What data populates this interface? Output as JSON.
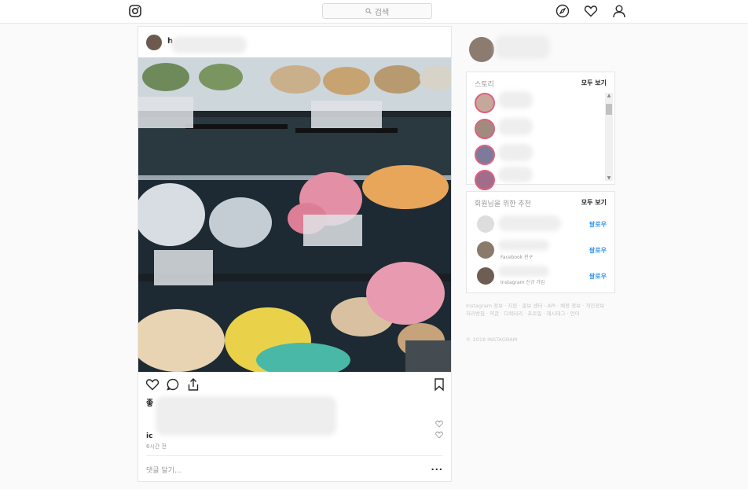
{
  "header": {
    "search_placeholder": "검색",
    "search_icon": "search-icon",
    "icons": [
      "instagram-logo-icon",
      "explore-compass-icon",
      "heart-icon",
      "profile-icon"
    ]
  },
  "post": {
    "username": "h",
    "likes_prefix": "좋",
    "caption_suffix": "기",
    "comment_user": "ic",
    "time_ago": "6시간 전",
    "add_comment_placeholder": "댓글 달기...",
    "more_label": "..."
  },
  "stories": {
    "title": "스토리",
    "see_all": "모두 보기"
  },
  "suggestions": {
    "title": "회원님을 위한 추천",
    "see_all": "모두 보기",
    "items": [
      {
        "sub": "",
        "follow": "팔로우"
      },
      {
        "sub": "Facebook 친구",
        "follow": "팔로우"
      },
      {
        "sub": "Instagram 신규 가입",
        "follow": "팔로우"
      }
    ]
  },
  "footer": {
    "links": "Instagram 정보 · 지원 · 홍보 센터 · API · 채용 정보 · 개인정보처리방침 · 약관 · 디렉터리 · 프로필 · 해시태그 · 언어",
    "copyright": "© 2018 INSTAGRAM"
  },
  "colors": {
    "accent": "#3897f0",
    "story_ring": "#e0607e"
  }
}
